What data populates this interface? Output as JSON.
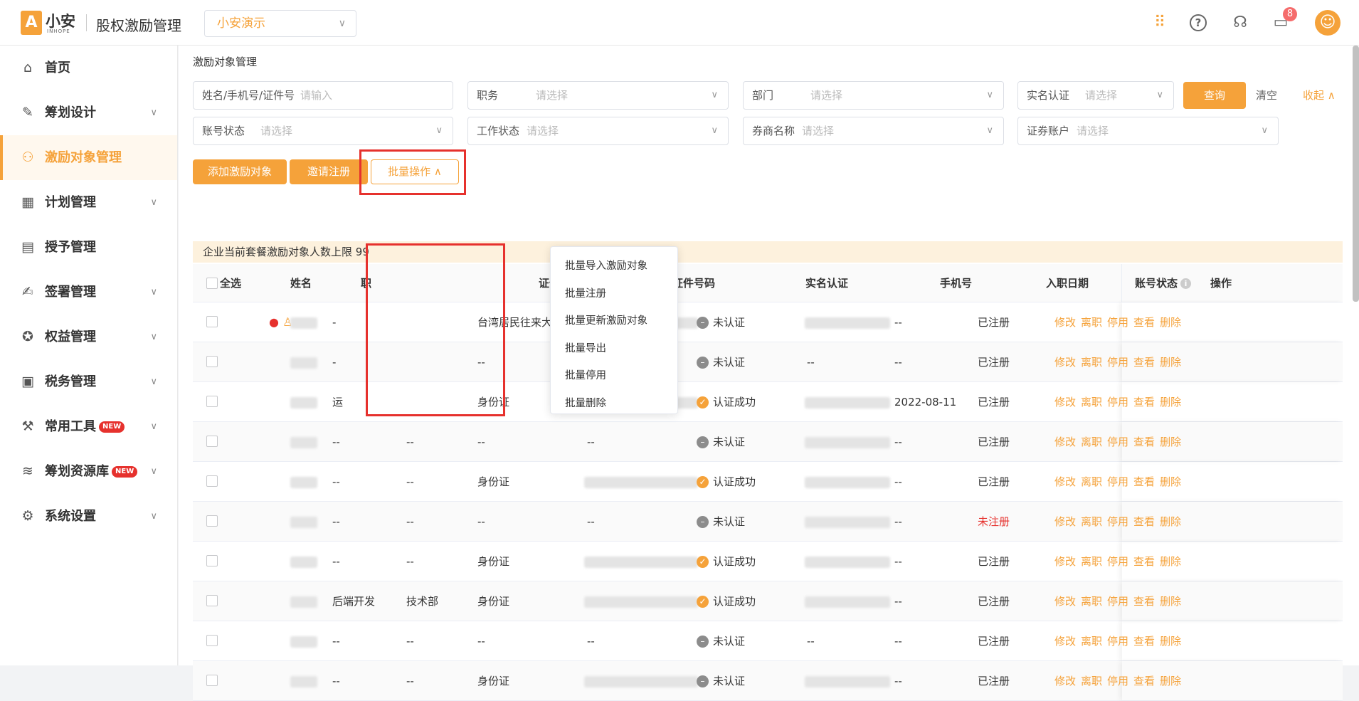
{
  "header": {
    "logo_char": "A",
    "logo_text": "小安",
    "logo_sub": "INHOPE",
    "app_title": "股权激励管理",
    "company": "小安演示",
    "message_count": "8"
  },
  "sidebar": {
    "items": [
      {
        "label": "首页",
        "icon": "home-icon",
        "glyph": "⌂",
        "has_chevron": false
      },
      {
        "label": "筹划设计",
        "icon": "edit-icon",
        "glyph": "✎",
        "has_chevron": true
      },
      {
        "label": "激励对象管理",
        "icon": "users-icon",
        "glyph": "⚇",
        "has_chevron": false,
        "active": true
      },
      {
        "label": "计划管理",
        "icon": "grid-icon",
        "glyph": "▦",
        "has_chevron": true
      },
      {
        "label": "授予管理",
        "icon": "book-icon",
        "glyph": "▤",
        "has_chevron": false
      },
      {
        "label": "签署管理",
        "icon": "sign-icon",
        "glyph": "✍",
        "has_chevron": true
      },
      {
        "label": "权益管理",
        "icon": "star-icon",
        "glyph": "✪",
        "has_chevron": true
      },
      {
        "label": "税务管理",
        "icon": "tax-icon",
        "glyph": "▣",
        "has_chevron": true
      },
      {
        "label": "常用工具",
        "icon": "toolbox-icon",
        "glyph": "⚒",
        "has_chevron": true,
        "badge": "NEW"
      },
      {
        "label": "筹划资源库",
        "icon": "layers-icon",
        "glyph": "≋",
        "has_chevron": true,
        "badge": "NEW"
      },
      {
        "label": "系统设置",
        "icon": "settings-icon",
        "glyph": "⚙",
        "has_chevron": true
      }
    ]
  },
  "page": {
    "title": "激励对象管理"
  },
  "filters": {
    "name_label": "姓名/手机号/证件号",
    "name_placeholder": "请输入",
    "position_label": "职务",
    "department_label": "部门",
    "realname_label": "实名认证",
    "account_status_label": "账号状态",
    "work_status_label": "工作状态",
    "broker_label": "券商名称",
    "securities_label": "证券账户",
    "select_placeholder": "请选择",
    "query": "查询",
    "clear": "清空",
    "collapse": "收起"
  },
  "actions": {
    "add": "添加激励对象",
    "invite": "邀请注册",
    "batch": "批量操作"
  },
  "notice": "企业当前套餐激励对象人数上限 99",
  "dropdown": {
    "items": [
      "批量导入激励对象",
      "批量注册",
      "批量更新激励对象",
      "批量导出",
      "批量停用",
      "批量删除"
    ]
  },
  "table": {
    "headers": {
      "select_all": "全选",
      "name": "姓名",
      "position": "职",
      "id_type": "证件类型",
      "id_number": "证件号码",
      "realname": "实名认证",
      "phone": "手机号",
      "join_date": "入职日期",
      "account_status": "账号状态",
      "ops": "操作"
    },
    "op_labels": [
      "修改",
      "离职",
      "停用",
      "查看",
      "删除"
    ],
    "rows": [
      {
        "position": "-",
        "dept": "",
        "id_type": "台湾居民往来大陆通行证",
        "realname": "未认证",
        "verified": false,
        "join_date": "--",
        "status": "已注册",
        "icons": true
      },
      {
        "position": "-",
        "dept": "",
        "id_type": "--",
        "realname": "未认证",
        "verified": false,
        "join_date": "--",
        "status": "已注册",
        "no_idnum": true,
        "no_phone": true
      },
      {
        "position": "运",
        "dept": "",
        "id_type": "身份证",
        "realname": "认证成功",
        "verified": true,
        "join_date": "2022-08-11",
        "status": "已注册"
      },
      {
        "position": "--",
        "dept": "--",
        "id_type": "--",
        "realname": "未认证",
        "verified": false,
        "join_date": "--",
        "status": "已注册",
        "no_idnum": true
      },
      {
        "position": "--",
        "dept": "--",
        "id_type": "身份证",
        "realname": "认证成功",
        "verified": true,
        "join_date": "--",
        "status": "已注册"
      },
      {
        "position": "--",
        "dept": "--",
        "id_type": "--",
        "realname": "未认证",
        "verified": false,
        "join_date": "--",
        "status": "未注册",
        "no_idnum": true
      },
      {
        "position": "--",
        "dept": "--",
        "id_type": "身份证",
        "realname": "认证成功",
        "verified": true,
        "join_date": "--",
        "status": "已注册"
      },
      {
        "position": "后端开发",
        "dept": "技术部",
        "id_type": "身份证",
        "realname": "认证成功",
        "verified": true,
        "join_date": "--",
        "status": "已注册"
      },
      {
        "position": "--",
        "dept": "--",
        "id_type": "--",
        "realname": "未认证",
        "verified": false,
        "join_date": "--",
        "status": "已注册",
        "no_idnum": true,
        "no_phone": true
      },
      {
        "position": "--",
        "dept": "--",
        "id_type": "身份证",
        "realname": "未认证",
        "verified": false,
        "join_date": "--",
        "status": "已注册"
      }
    ],
    "empty": "--"
  },
  "colors": {
    "accent": "#f5a23a",
    "highlight_box": "#e6312d"
  }
}
